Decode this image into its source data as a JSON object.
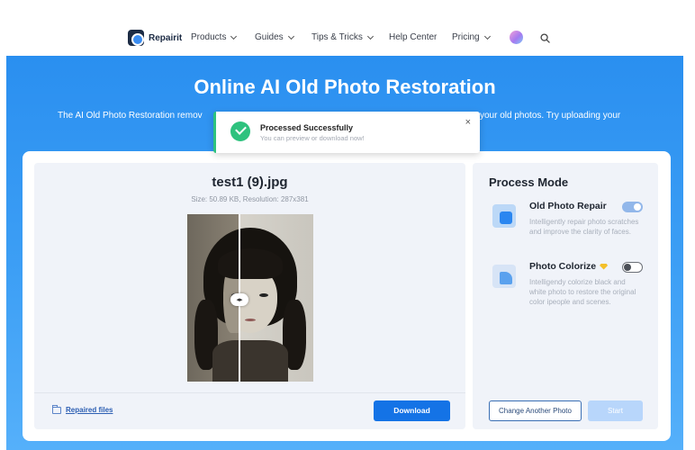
{
  "nav": {
    "brand": "Repairit",
    "items": [
      {
        "label": "Products"
      },
      {
        "label": "Guides"
      },
      {
        "label": "Tips & Tricks"
      },
      {
        "label": "Help Center"
      },
      {
        "label": "Pricing"
      }
    ]
  },
  "hero": {
    "title": "Online AI Old Photo Restoration",
    "subtitle_left": "The AI Old Photo Restoration remov",
    "subtitle_right": "your old photos. Try uploading your"
  },
  "toast": {
    "title": "Processed Successfully",
    "message": "You can preview or download now!",
    "close": "×"
  },
  "preview": {
    "file_name": "test1 (9).jpg",
    "meta": "Size: 50.89 KB, Resolution: 287x381",
    "repaired_files": "Repaired files",
    "download": "Download"
  },
  "process_mode": {
    "title": "Process Mode",
    "modes": [
      {
        "name": "Old Photo Repair",
        "desc": "Intelligently repair photo scratches and improve the clarity of faces.",
        "enabled": true
      },
      {
        "name": "Photo Colorize",
        "desc": "Intelligendy colorize black and white photo to restore the original color ipeople and scenes.",
        "enabled": false,
        "premium_icon": "gem-icon"
      }
    ],
    "change_photo": "Change Another Photo",
    "start": "Start"
  },
  "colors": {
    "accent": "#1473e6",
    "hero": "#2a8ff0",
    "success": "#2ec27e"
  }
}
